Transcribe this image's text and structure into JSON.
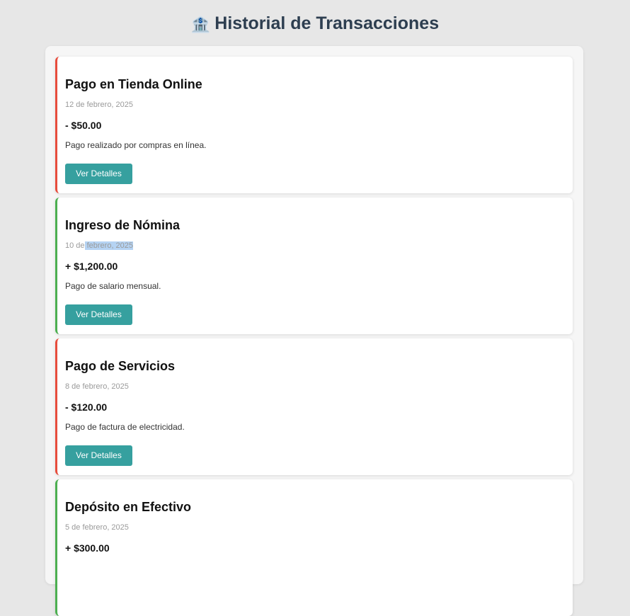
{
  "header": {
    "icon": "bank-icon",
    "title": "Historial de Transacciones"
  },
  "colors": {
    "expense_border": "#e74c3c",
    "income_border": "#4caf50",
    "button": "#36a09f",
    "title": "#2d3e50"
  },
  "transactions": [
    {
      "type": "expense",
      "title": "Pago en Tienda Online",
      "date": "12 de febrero, 2025",
      "amount": "- $50.00",
      "description": "Pago realizado por compras en línea.",
      "button_label": "Ver Detalles"
    },
    {
      "type": "income",
      "title": "Ingreso de Nómina",
      "date_prefix": "10 de",
      "date_selected": " febrero, 2025",
      "amount": "+ $1,200.00",
      "description": "Pago de salario mensual.",
      "button_label": "Ver Detalles"
    },
    {
      "type": "expense",
      "title": "Pago de Servicios",
      "date": "8 de febrero, 2025",
      "amount": "- $120.00",
      "description": "Pago de factura de electricidad.",
      "button_label": "Ver Detalles"
    },
    {
      "type": "income",
      "title": "Depósito en Efectivo",
      "date": "5 de febrero, 2025",
      "amount": "+ $300.00"
    }
  ]
}
